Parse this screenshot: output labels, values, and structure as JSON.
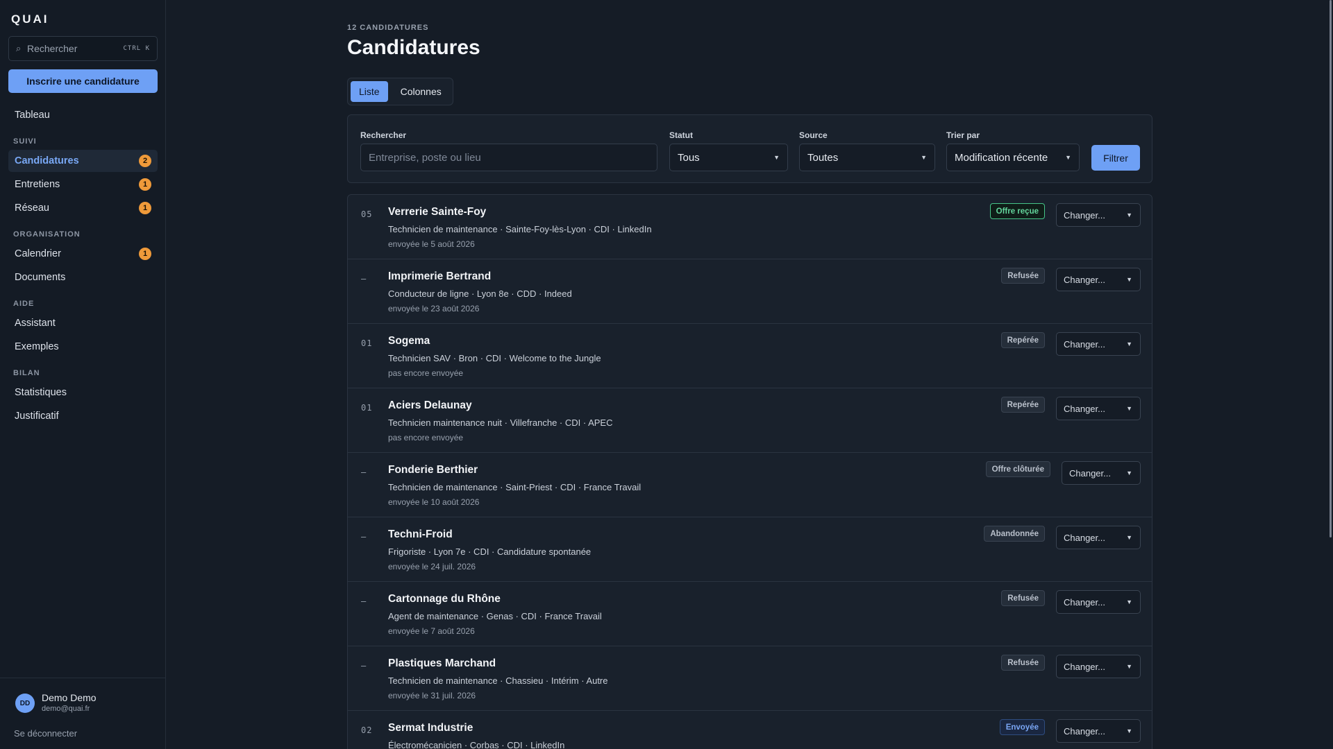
{
  "app": {
    "logo": "QUAI"
  },
  "sidebar": {
    "search_placeholder": "Rechercher",
    "search_shortcut": "CTRL K",
    "primary_action": "Inscrire une candidature",
    "nav": [
      {
        "type": "item",
        "label": "Tableau",
        "badge": ""
      },
      {
        "type": "section",
        "label": "SUIVI"
      },
      {
        "type": "item",
        "label": "Candidatures",
        "badge": "2",
        "active": true
      },
      {
        "type": "item",
        "label": "Entretiens",
        "badge": "1"
      },
      {
        "type": "item",
        "label": "Réseau",
        "badge": "1"
      },
      {
        "type": "section",
        "label": "ORGANISATION"
      },
      {
        "type": "item",
        "label": "Calendrier",
        "badge": "1"
      },
      {
        "type": "item",
        "label": "Documents",
        "badge": ""
      },
      {
        "type": "section",
        "label": "AIDE"
      },
      {
        "type": "item",
        "label": "Assistant",
        "badge": ""
      },
      {
        "type": "item",
        "label": "Exemples",
        "badge": ""
      },
      {
        "type": "section",
        "label": "BILAN"
      },
      {
        "type": "item",
        "label": "Statistiques",
        "badge": ""
      },
      {
        "type": "item",
        "label": "Justificatif",
        "badge": ""
      }
    ],
    "user": {
      "initials": "DD",
      "name": "Demo Demo",
      "email": "demo@quai.fr"
    },
    "logout": "Se déconnecter"
  },
  "main": {
    "count_label": "12 CANDIDATURES",
    "title": "Candidatures",
    "views": [
      "Liste",
      "Colonnes"
    ],
    "active_view": "Liste",
    "filters": {
      "search_label": "Rechercher",
      "search_placeholder": "Entreprise, poste ou lieu",
      "status_label": "Statut",
      "status_value": "Tous",
      "source_label": "Source",
      "source_value": "Toutes",
      "sort_label": "Trier par",
      "sort_value": "Modification récente",
      "submit": "Filtrer"
    },
    "change_label": "Changer...",
    "applications": [
      {
        "num": "05",
        "company": "Verrerie Sainte-Foy",
        "details": "Technicien de maintenance · Sainte-Foy-lès-Lyon · CDI · LinkedIn",
        "sent": "envoyée le 5 août 2026",
        "status": "Offre reçue",
        "status_style": "green"
      },
      {
        "num": "—",
        "company": "Imprimerie Bertrand",
        "details": "Conducteur de ligne · Lyon 8e · CDD · Indeed",
        "sent": "envoyée le 23 août 2026",
        "status": "Refusée",
        "status_style": "gray"
      },
      {
        "num": "01",
        "company": "Sogema",
        "details": "Technicien SAV · Bron · CDI · Welcome to the Jungle",
        "sent": "pas encore envoyée",
        "status": "Repérée",
        "status_style": "gray"
      },
      {
        "num": "01",
        "company": "Aciers Delaunay",
        "details": "Technicien maintenance nuit · Villefranche · CDI · APEC",
        "sent": "pas encore envoyée",
        "status": "Repérée",
        "status_style": "gray"
      },
      {
        "num": "—",
        "company": "Fonderie Berthier",
        "details": "Technicien de maintenance · Saint-Priest · CDI · France Travail",
        "sent": "envoyée le 10 août 2026",
        "status": "Offre clôturée",
        "status_style": "gray"
      },
      {
        "num": "—",
        "company": "Techni-Froid",
        "details": "Frigoriste · Lyon 7e · CDI · Candidature spontanée",
        "sent": "envoyée le 24 juil. 2026",
        "status": "Abandonnée",
        "status_style": "gray"
      },
      {
        "num": "—",
        "company": "Cartonnage du Rhône",
        "details": "Agent de maintenance · Genas · CDI · France Travail",
        "sent": "envoyée le 7 août 2026",
        "status": "Refusée",
        "status_style": "gray"
      },
      {
        "num": "—",
        "company": "Plastiques Marchand",
        "details": "Technicien de maintenance · Chassieu · Intérim · Autre",
        "sent": "envoyée le 31 juil. 2026",
        "status": "Refusée",
        "status_style": "gray"
      },
      {
        "num": "02",
        "company": "Sermat Industrie",
        "details": "Électromécanicien · Corbas · CDI · LinkedIn",
        "sent": "",
        "status": "Envoyée",
        "status_style": "blue"
      }
    ]
  }
}
